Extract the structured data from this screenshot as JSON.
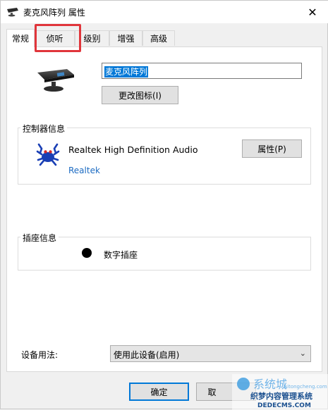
{
  "window": {
    "title": "麦克风阵列 属性",
    "close_glyph": "✕"
  },
  "tabs": [
    {
      "label": "常规",
      "active": true
    },
    {
      "label": "侦听",
      "active": false
    },
    {
      "label": "级别",
      "active": false
    },
    {
      "label": "增强",
      "active": false
    },
    {
      "label": "高级",
      "active": false
    }
  ],
  "general": {
    "device_name": "麦克风阵列",
    "change_icon_label": "更改图标(I)",
    "controller": {
      "group_label": "控制器信息",
      "name": "Realtek High Definition Audio",
      "vendor": "Realtek",
      "properties_label": "属性(P)"
    },
    "jack": {
      "group_label": "插座信息",
      "type": "数字插座"
    },
    "usage": {
      "label": "设备用法:",
      "selected": "使用此设备(启用)"
    }
  },
  "footer": {
    "ok_label": "确定",
    "cancel_label": "取"
  },
  "watermark": {
    "line1": "系统城",
    "line2": "xitongcheng.com",
    "line3": "织梦内容管理系统",
    "line4": "DEDECMS.COM"
  },
  "colors": {
    "accent": "#0078d7",
    "highlight_box": "#e0353b",
    "link": "#1c6bc2"
  },
  "icons": {
    "title": "microphone-array-icon",
    "device": "microphone-array-icon",
    "controller": "realtek-crab-icon",
    "jack": "digital-jack-dot-icon",
    "dropdown": "chevron-down-icon"
  }
}
